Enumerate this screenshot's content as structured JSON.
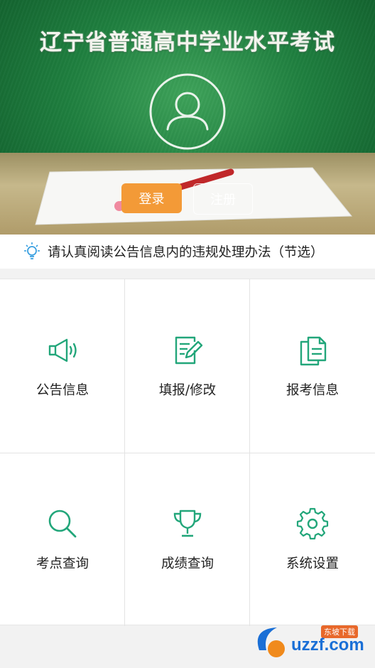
{
  "header": {
    "title": "辽宁省普通高中学业水平考试",
    "login_label": "登录",
    "register_label": "注册"
  },
  "notice": {
    "text": "请认真阅读公告信息内的违规处理办法（节选）"
  },
  "menu": {
    "items": [
      {
        "label": "公告信息",
        "icon": "megaphone-icon"
      },
      {
        "label": "填报/修改",
        "icon": "edit-form-icon"
      },
      {
        "label": "报考信息",
        "icon": "documents-icon"
      },
      {
        "label": "考点查询",
        "icon": "search-icon"
      },
      {
        "label": "成绩查询",
        "icon": "trophy-icon"
      },
      {
        "label": "系统设置",
        "icon": "gear-icon"
      }
    ]
  },
  "watermark": {
    "text": "uzzf.com",
    "sub": "东坡下载"
  },
  "colors": {
    "accent_green": "#22a67a",
    "login_orange": "#f39a37",
    "board_green": "#1f7f3f"
  }
}
